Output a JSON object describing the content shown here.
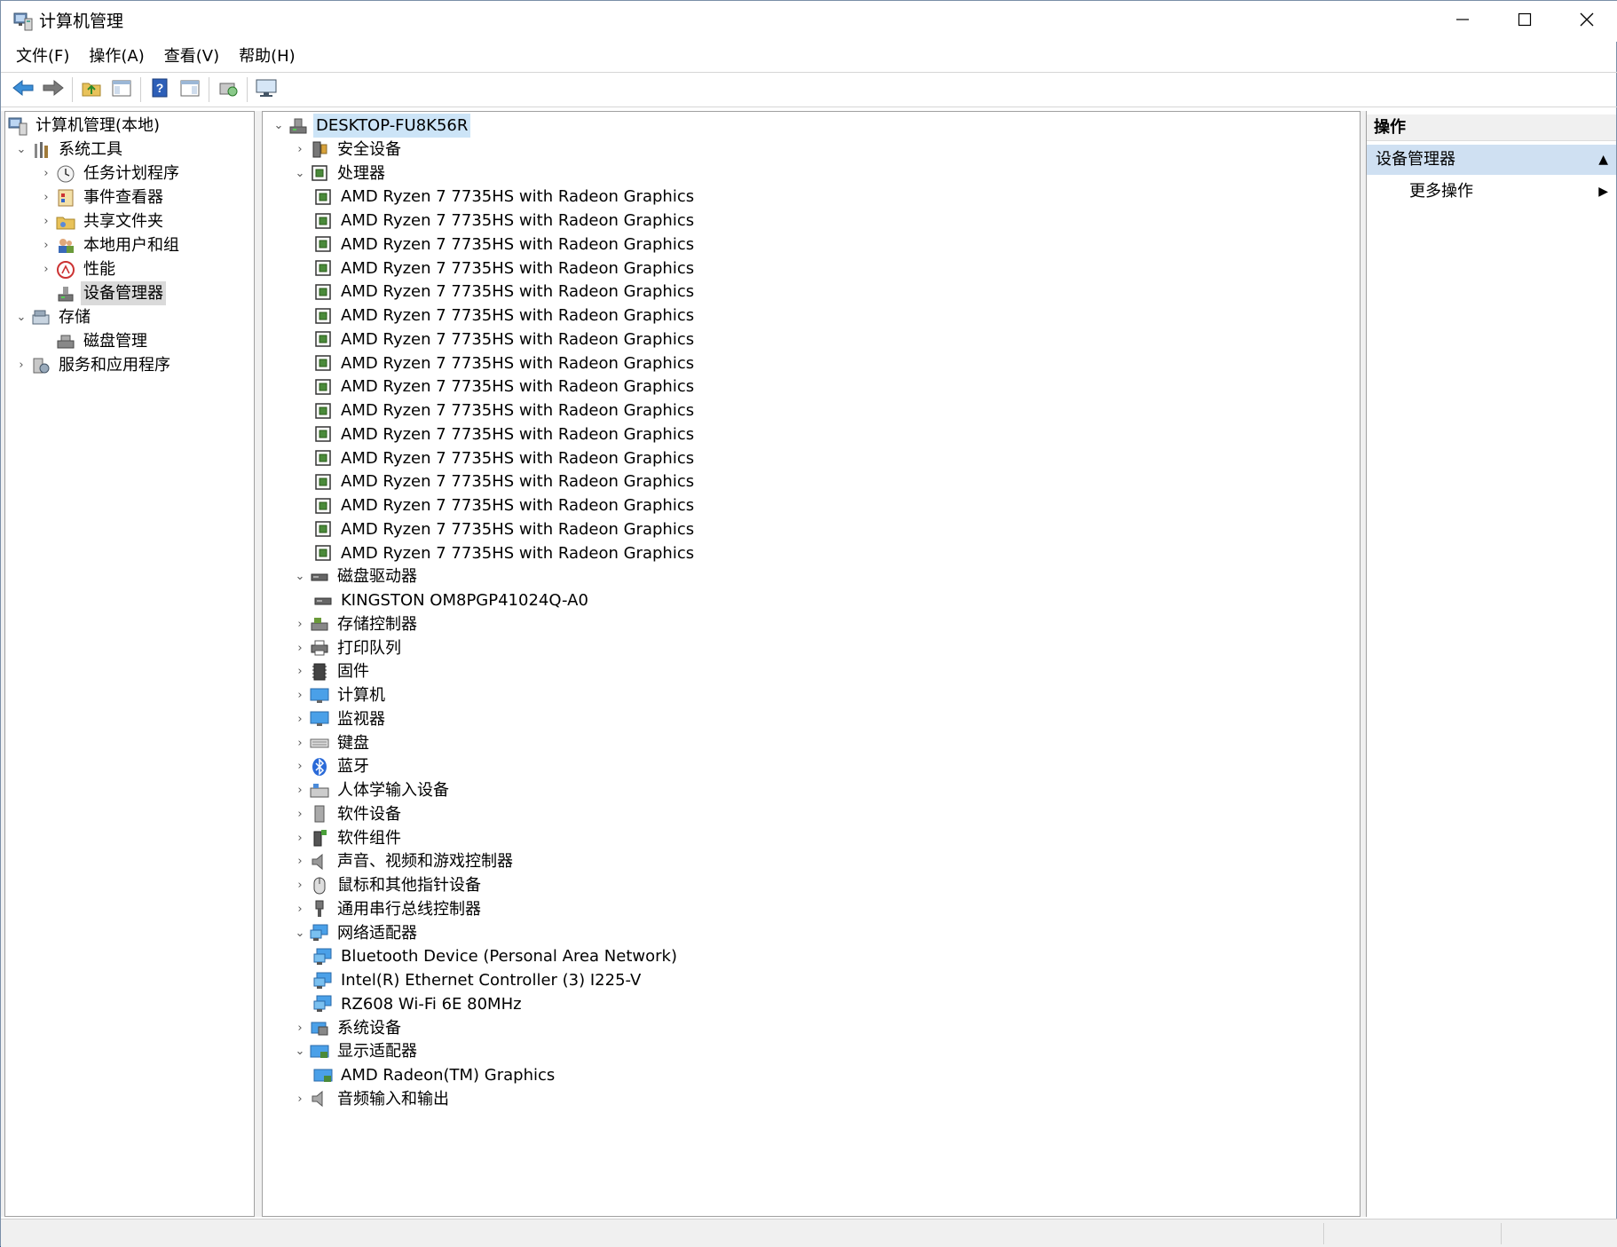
{
  "window": {
    "title": "计算机管理"
  },
  "menu": [
    "文件(F)",
    "操作(A)",
    "查看(V)",
    "帮助(H)"
  ],
  "toolbar": [
    "back-icon",
    "forward-icon",
    "up-folder-icon",
    "show-hide-tree-icon",
    "help-icon",
    "show-hide-action-icon",
    "scan-hardware-icon",
    "monitor-icon"
  ],
  "left_tree": {
    "root": "计算机管理(本地)",
    "system_tools": "系统工具",
    "task_scheduler": "任务计划程序",
    "event_viewer": "事件查看器",
    "shared_folders": "共享文件夹",
    "local_users": "本地用户和组",
    "performance": "性能",
    "device_manager": "设备管理器",
    "storage": "存储",
    "disk_management": "磁盘管理",
    "services_apps": "服务和应用程序"
  },
  "device_tree": {
    "computer": "DESKTOP-FU8K56R",
    "categories": {
      "security": "安全设备",
      "processors": "处理器",
      "disk_drives": "磁盘驱动器",
      "storage_ctrl": "存储控制器",
      "print_queue": "打印队列",
      "firmware": "固件",
      "computer": "计算机",
      "monitors": "监视器",
      "keyboards": "键盘",
      "bluetooth": "蓝牙",
      "hid": "人体学输入设备",
      "software_devices": "软件设备",
      "software_components": "软件组件",
      "sound": "声音、视频和游戏控制器",
      "mice": "鼠标和其他指针设备",
      "usb": "通用串行总线控制器",
      "network": "网络适配器",
      "system_devices": "系统设备",
      "display": "显示适配器",
      "audio_io": "音频输入和输出"
    },
    "processors": [
      "AMD Ryzen 7 7735HS with Radeon Graphics",
      "AMD Ryzen 7 7735HS with Radeon Graphics",
      "AMD Ryzen 7 7735HS with Radeon Graphics",
      "AMD Ryzen 7 7735HS with Radeon Graphics",
      "AMD Ryzen 7 7735HS with Radeon Graphics",
      "AMD Ryzen 7 7735HS with Radeon Graphics",
      "AMD Ryzen 7 7735HS with Radeon Graphics",
      "AMD Ryzen 7 7735HS with Radeon Graphics",
      "AMD Ryzen 7 7735HS with Radeon Graphics",
      "AMD Ryzen 7 7735HS with Radeon Graphics",
      "AMD Ryzen 7 7735HS with Radeon Graphics",
      "AMD Ryzen 7 7735HS with Radeon Graphics",
      "AMD Ryzen 7 7735HS with Radeon Graphics",
      "AMD Ryzen 7 7735HS with Radeon Graphics",
      "AMD Ryzen 7 7735HS with Radeon Graphics",
      "AMD Ryzen 7 7735HS with Radeon Graphics"
    ],
    "disks": [
      "KINGSTON OM8PGP41024Q-A0"
    ],
    "network_adapters": [
      "Bluetooth Device (Personal Area Network)",
      "Intel(R) Ethernet Controller (3) I225-V",
      "RZ608 Wi-Fi 6E 80MHz"
    ],
    "display_adapters": [
      "AMD Radeon(TM) Graphics"
    ]
  },
  "actions": {
    "header": "操作",
    "section": "设备管理器",
    "more": "更多操作"
  }
}
